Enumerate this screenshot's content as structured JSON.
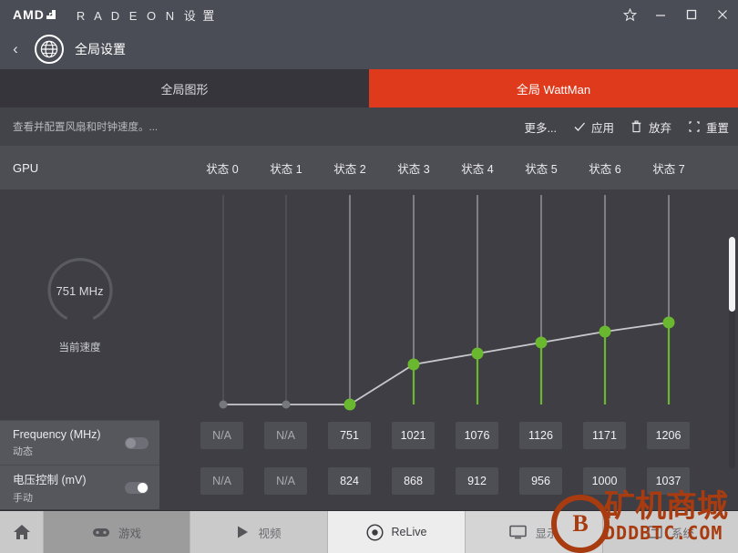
{
  "window": {
    "brand_logo": "AMD",
    "brand_text": "R A D E O N",
    "brand_text_cn": "设 置",
    "controls": {
      "favorite": "star-icon",
      "minimize": "minimize-icon",
      "maximize": "maximize-icon",
      "close": "close-icon"
    }
  },
  "breadcrumb": {
    "back": "‹",
    "icon": "globe-icon",
    "title": "全局设置"
  },
  "tabs": [
    {
      "label": "全局图形",
      "active": false
    },
    {
      "label": "全局 WattMan",
      "active": true
    }
  ],
  "actionbar": {
    "description": "查看并配置风扇和时钟速度。...",
    "buttons": [
      {
        "label": "更多...",
        "icon": ""
      },
      {
        "label": "应用",
        "icon": "check-icon"
      },
      {
        "label": "放弃",
        "icon": "trash-icon"
      },
      {
        "label": "重置",
        "icon": "reset-icon"
      }
    ]
  },
  "sidebar": {
    "header": "GPU",
    "gauge": {
      "value": "751 MHz",
      "caption": "当前速度"
    },
    "toggles": [
      {
        "label": "Frequency (MHz)",
        "sublabel": "动态",
        "state": "off"
      },
      {
        "label": "电压控制 (mV)",
        "sublabel": "手动",
        "state": "on"
      }
    ]
  },
  "colors": {
    "accent": "#e03a1c",
    "curve_point": "#6ab82f",
    "curve_line": "#c8c8cc",
    "panel": "#3e3e44",
    "header": "#4d4d54",
    "watermark": "#a83c10"
  },
  "chart_data": {
    "type": "line",
    "title": "",
    "xlabel": "",
    "ylabel": "",
    "grid": true,
    "legend": "none",
    "categories": [
      "状态 0",
      "状态 1",
      "状态 2",
      "状态 3",
      "状态 4",
      "状态 5",
      "状态 6",
      "状态 7"
    ],
    "series": [
      {
        "name": "Frequency (MHz)",
        "row_label": "Frequency (MHz)",
        "values": [
          "N/A",
          "N/A",
          751,
          1021,
          1076,
          1126,
          1171,
          1206
        ]
      },
      {
        "name": "电压控制 (mV)",
        "row_label": "电压控制 (mV)",
        "values": [
          "N/A",
          "N/A",
          824,
          868,
          912,
          956,
          1000,
          1037
        ]
      }
    ],
    "plotted_series": "Frequency (MHz)",
    "active_points": [
      751,
      1021,
      1076,
      1126,
      1171,
      1206
    ],
    "inactive_points": [
      "N/A",
      "N/A"
    ],
    "ylim": [
      700,
      1300
    ]
  },
  "scrollbar": {
    "orientation": "vertical",
    "position": "top"
  },
  "bottomnav": [
    {
      "label": "",
      "icon": "home-icon",
      "name": "home"
    },
    {
      "label": "游戏",
      "icon": "gamepad-icon",
      "name": "gaming"
    },
    {
      "label": "视频",
      "icon": "play-icon",
      "name": "video"
    },
    {
      "label": "ReLive",
      "icon": "relive-icon",
      "name": "relive"
    },
    {
      "label": "显示",
      "icon": "monitor-icon",
      "name": "display"
    },
    {
      "label": "系统",
      "icon": "system-icon",
      "name": "system"
    }
  ],
  "watermark": {
    "coin": "B",
    "text_cn": "矿机商城",
    "text_en": "DDDBTC.COM"
  }
}
